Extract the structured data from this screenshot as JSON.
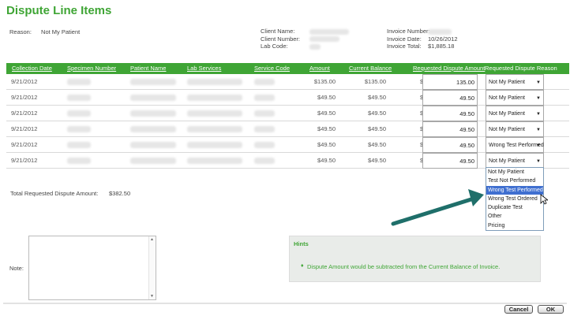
{
  "page": {
    "title": "Dispute Line Items"
  },
  "reason": {
    "label": "Reason:",
    "value": "Not My Patient"
  },
  "client": {
    "name_label": "Client Name:",
    "number_label": "Client Number:",
    "lab_code_label": "Lab Code:"
  },
  "invoice": {
    "number_label": "Invoice Number:",
    "date_label": "Invoice Date:",
    "date_value": "10/26/2012",
    "total_label": "Invoice Total:",
    "total_value": "$1,885.18"
  },
  "table": {
    "headers": {
      "collection_date": "Collection Date",
      "specimen_number": "Specimen Number",
      "patient_name": "Patient Name",
      "lab_services": "Lab Services",
      "service_code": "Service Code",
      "amount": "Amount",
      "current_balance": "Current Balance",
      "requested_amount": "Requested Dispute Amount",
      "requested_reason": "Requested Dispute Reason"
    },
    "currency_symbol": "$",
    "rows": [
      {
        "date": "9/21/2012",
        "amount": "$135.00",
        "balance": "$135.00",
        "requested": "135.00",
        "reason": "Not My Patient"
      },
      {
        "date": "9/21/2012",
        "amount": "$49.50",
        "balance": "$49.50",
        "requested": "49.50",
        "reason": "Not My Patient"
      },
      {
        "date": "9/21/2012",
        "amount": "$49.50",
        "balance": "$49.50",
        "requested": "49.50",
        "reason": "Not My Patient"
      },
      {
        "date": "9/21/2012",
        "amount": "$49.50",
        "balance": "$49.50",
        "requested": "49.50",
        "reason": "Not My Patient"
      },
      {
        "date": "9/21/2012",
        "amount": "$49.50",
        "balance": "$49.50",
        "requested": "49.50",
        "reason": "Wrong Test Performed"
      },
      {
        "date": "9/21/2012",
        "amount": "$49.50",
        "balance": "$49.50",
        "requested": "49.50",
        "reason": "Not My Patient"
      }
    ]
  },
  "dropdown": {
    "options": [
      "Not My Patient",
      "Test Not Performed",
      "Wrong Test Performed",
      "Wrong Test Ordered",
      "Duplicate Test",
      "Other",
      "Pricing"
    ],
    "highlighted": "Wrong Test Performed"
  },
  "total": {
    "label": "Total Requested Dispute Amount:",
    "value": "$382.50"
  },
  "note": {
    "label": "Note:",
    "value": ""
  },
  "hints": {
    "title": "Hints",
    "bullet": "♦",
    "items": [
      "Dispute Amount would be subtracted from the Current Balance of Invoice."
    ]
  },
  "buttons": {
    "cancel": "Cancel",
    "ok": "OK"
  },
  "colors": {
    "accent": "#3fa535",
    "arrow": "#1f6f6a",
    "selection": "#3f6fd0"
  },
  "icons": {
    "caret": "chevron-down-icon",
    "arrow": "annotation-arrow-icon",
    "cursor": "mouse-pointer-icon"
  }
}
